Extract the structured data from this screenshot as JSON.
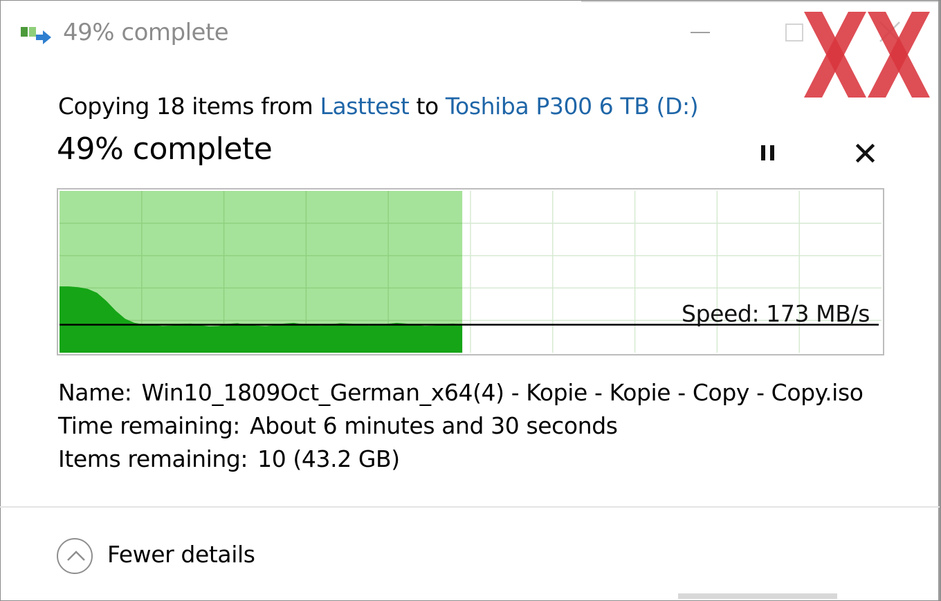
{
  "window": {
    "title": "49% complete",
    "icon": "file-copy-icon",
    "controls": {
      "minimize": "minimize-icon",
      "maximize": "maximize-icon",
      "close": "close-icon"
    },
    "watermark": "XX"
  },
  "copy": {
    "prefix": "Copying 18 items from",
    "source": "Lasttest",
    "joiner": "to",
    "destination": "Toshiba P300 6 TB (D:)"
  },
  "progress": {
    "label": "49% complete",
    "percent": 49,
    "pause_icon": "pause-icon",
    "cancel_icon": "close-icon"
  },
  "chart_data": {
    "type": "area",
    "title": "",
    "xlabel": "",
    "ylabel": "",
    "progress_fraction": 0.49,
    "current_speed_label": "Speed: 173 MB/s",
    "current_speed_mbps": 173,
    "grid": true,
    "fill_color": "#a6e39a",
    "series_color": "#16a517",
    "series": [
      {
        "values": [
          410,
          410,
          405,
          395,
          370,
          320,
          260,
          210,
          185,
          175,
          172,
          165,
          168,
          178,
          180,
          170,
          163,
          165,
          178,
          182,
          172,
          168,
          164,
          170,
          180,
          184,
          176,
          170,
          168,
          176,
          182,
          180,
          174,
          168,
          172,
          178,
          184,
          180,
          172,
          166,
          168,
          176,
          180,
          174
        ]
      }
    ]
  },
  "details": {
    "name_label": "Name:",
    "name_value": "Win10_1809Oct_German_x64(4) - Kopie - Kopie - Copy - Copy.iso",
    "time_label": "Time remaining:",
    "time_value": "About 6 minutes and 30 seconds",
    "items_label": "Items remaining:",
    "items_value": "10 (43.2 GB)"
  },
  "footer": {
    "toggle_label": "Fewer details",
    "toggle_icon": "chevron-up-icon"
  },
  "colors": {
    "link": "#1f66a8",
    "chart_fill": "#a6e39a",
    "chart_series": "#16a517",
    "speed_line": "#000000",
    "watermark": "#d9363e"
  }
}
